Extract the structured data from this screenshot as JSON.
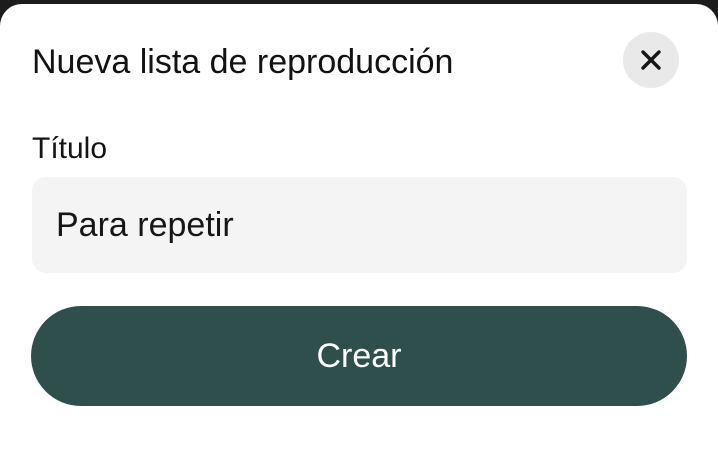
{
  "dialog": {
    "title": "Nueva lista de reproducción",
    "close_icon": "close-icon",
    "field_label": "Título",
    "input_value": "Para repetir",
    "submit_label": "Crear"
  },
  "colors": {
    "primary_button": "#2f4f4d",
    "input_background": "#f4f4f4",
    "close_button_background": "#e9e9e9"
  }
}
